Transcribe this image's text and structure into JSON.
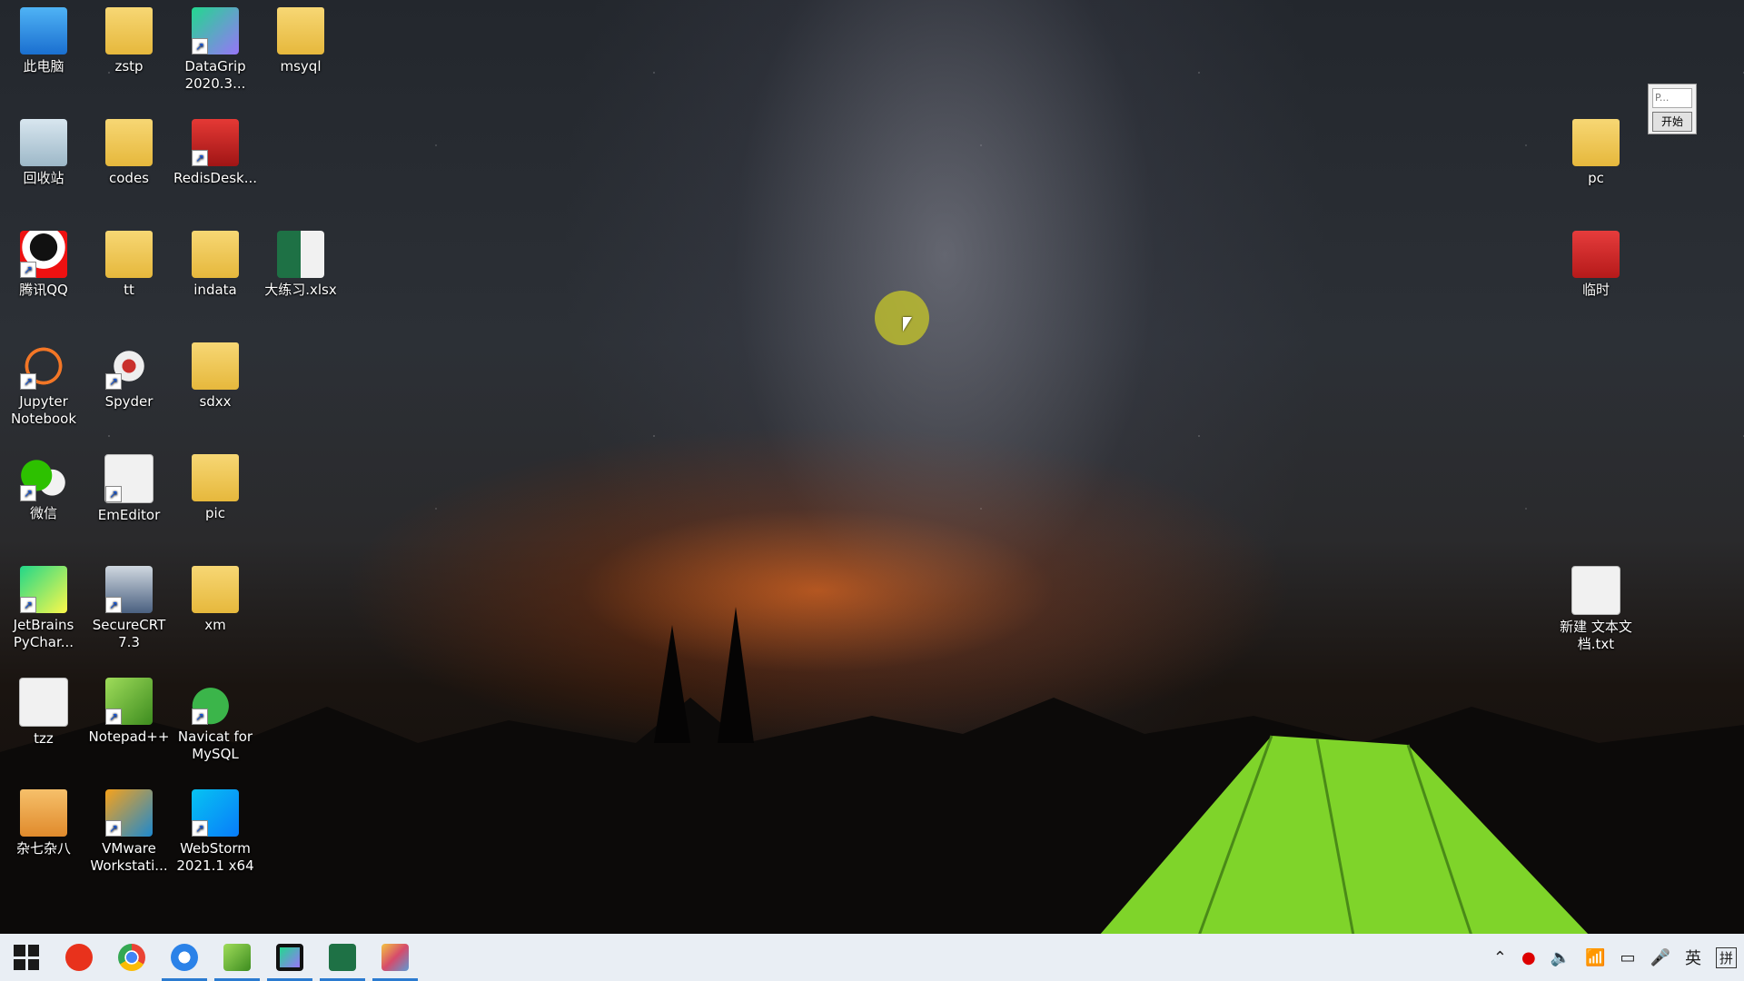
{
  "desktop_icons": [
    {
      "label": "此电脑"
    },
    {
      "label": "回收站"
    },
    {
      "label": "腾讯QQ"
    },
    {
      "label": "Jupyter\nNotebook"
    },
    {
      "label": "微信"
    },
    {
      "label": "JetBrains\nPyChar..."
    },
    {
      "label": "tzz"
    },
    {
      "label": "杂七杂八"
    },
    {
      "label": "zstp"
    },
    {
      "label": "codes"
    },
    {
      "label": "tt"
    },
    {
      "label": "Spyder"
    },
    {
      "label": "EmEditor"
    },
    {
      "label": "SecureCRT\n7.3"
    },
    {
      "label": "Notepad++"
    },
    {
      "label": "VMware\nWorkstati..."
    },
    {
      "label": "DataGrip\n2020.3..."
    },
    {
      "label": "RedisDesk..."
    },
    {
      "label": "indata"
    },
    {
      "label": "sdxx"
    },
    {
      "label": "pic"
    },
    {
      "label": "xm"
    },
    {
      "label": "Navicat for\nMySQL"
    },
    {
      "label": "WebStorm\n2021.1 x64"
    },
    {
      "label": "msyql"
    },
    {
      "label": "大练习.xlsx"
    },
    {
      "label": "pc"
    },
    {
      "label": "临时"
    },
    {
      "label": "新建 文本文\n档.txt"
    }
  ],
  "mini_window": {
    "input_text": "P...",
    "button_label": "开始"
  },
  "taskbar": {
    "items": [
      {
        "icon": "windows-start-icon",
        "color": "#1a1a1a"
      },
      {
        "icon": "red-g-app-icon",
        "color": "#e8321c"
      },
      {
        "icon": "chrome-icon",
        "color": "#34a853"
      },
      {
        "icon": "browser-icon",
        "color": "#2b82e8"
      },
      {
        "icon": "notepad-plus-icon",
        "color": "#6ab04c"
      },
      {
        "icon": "datagrip-icon",
        "color": "#2a2a2a"
      },
      {
        "icon": "excel-icon",
        "color": "#1e7145"
      },
      {
        "icon": "paint-icon",
        "color": "#d64b6b"
      }
    ],
    "tray": {
      "input_lang": "英",
      "ime_mode": "拼"
    }
  }
}
